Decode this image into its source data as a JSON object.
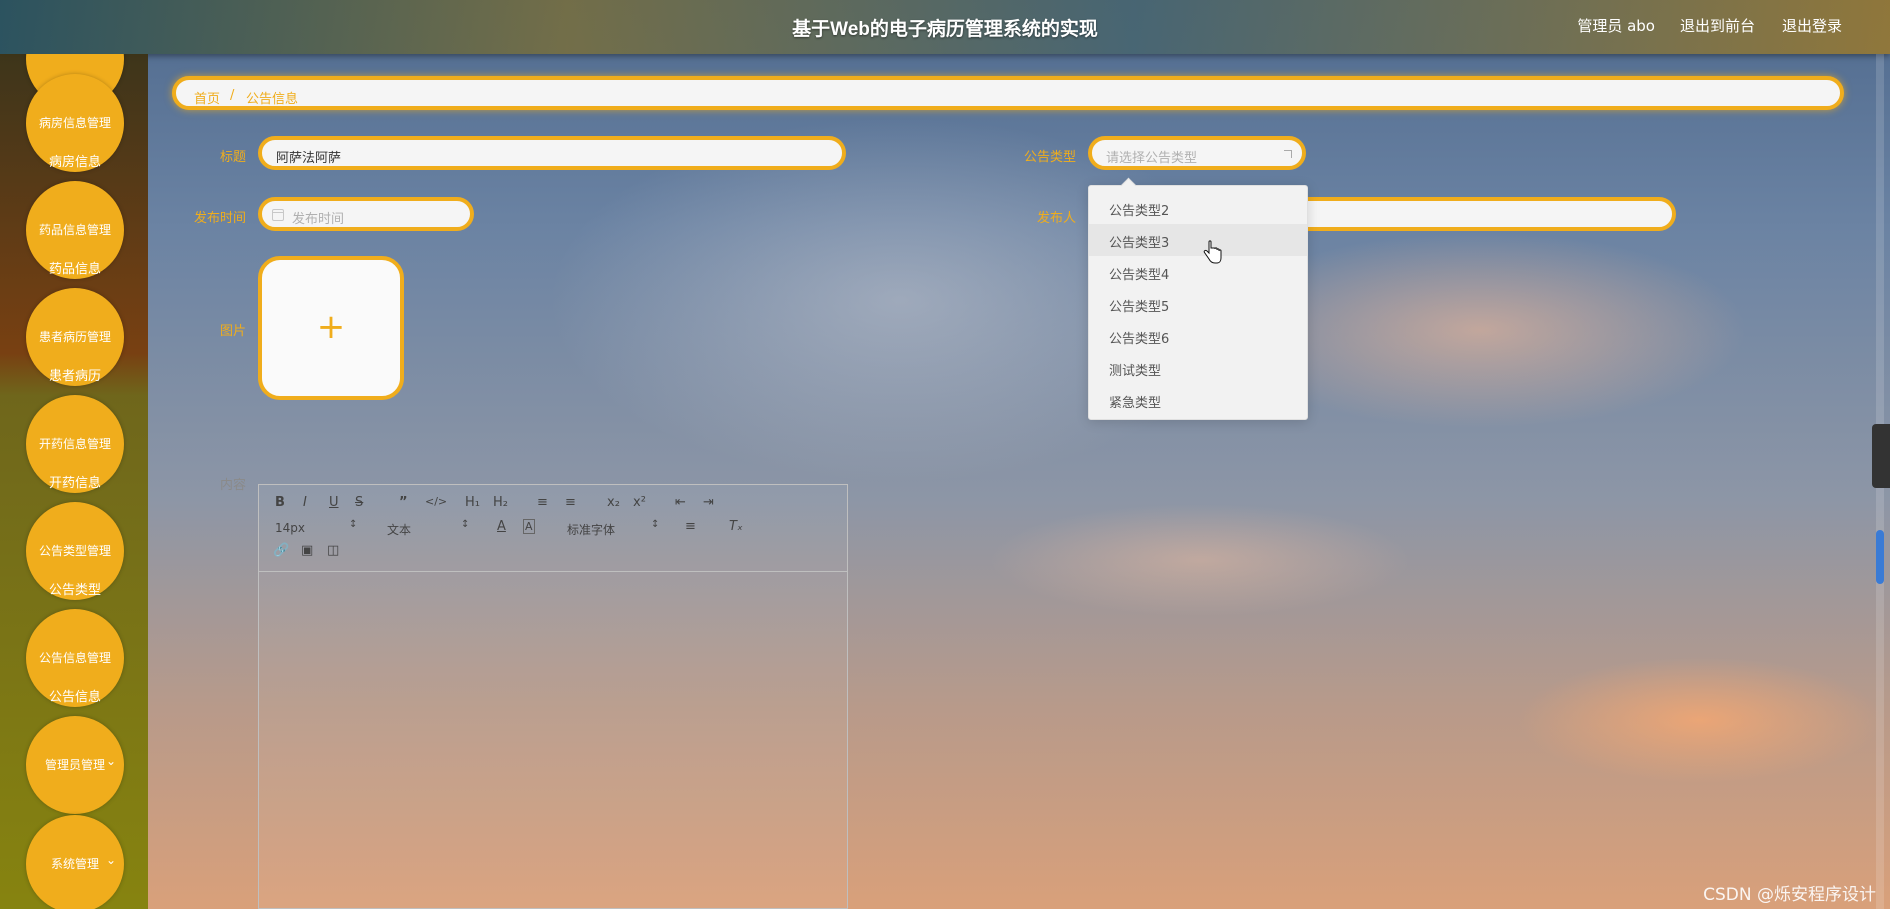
{
  "header": {
    "title": "基于Web的电子病历管理系统的实现",
    "user": "管理员 abo",
    "front_link": "退出到前台",
    "logout": "退出登录"
  },
  "sidebar": {
    "items": [
      {
        "top": "病房信息管理",
        "sub": "病房信息"
      },
      {
        "top": "药品信息管理",
        "sub": "药品信息"
      },
      {
        "top": "患者病历管理",
        "sub": "患者病历"
      },
      {
        "top": "开药信息管理",
        "sub": "开药信息"
      },
      {
        "top": "公告类型管理",
        "sub": "公告类型"
      },
      {
        "top": "公告信息管理",
        "sub": "公告信息"
      },
      {
        "top": "管理员管理"
      },
      {
        "top": "系统管理"
      }
    ]
  },
  "breadcrumb": {
    "home": "首页",
    "sep": "/",
    "current": "公告信息"
  },
  "form": {
    "title_label": "标题",
    "title_value": "阿萨法阿萨",
    "type_label": "公告类型",
    "type_placeholder": "请选择公告类型",
    "time_label": "发布时间",
    "time_placeholder": "发布时间",
    "publisher_label": "发布人",
    "image_label": "图片",
    "content_label": "内容",
    "plus": "+"
  },
  "editor": {
    "font_size": "14px",
    "paragraph": "文本",
    "font_family": "标准字体"
  },
  "dropdown": {
    "options": [
      "公告类型2",
      "公告类型3",
      "公告类型4",
      "公告类型5",
      "公告类型6",
      "测试类型",
      "紧急类型"
    ],
    "hovered": "公告类型3"
  },
  "watermark": "CSDN @烁安程序设计",
  "colors": {
    "accent": "#f0ad1c"
  }
}
